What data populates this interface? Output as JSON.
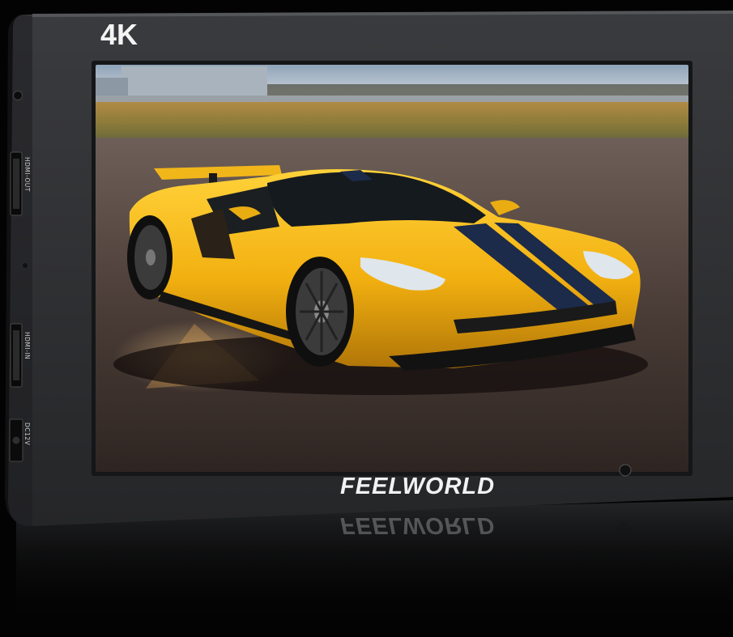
{
  "product": {
    "resolution_badge": "4K",
    "brand": "FEELWORLD"
  },
  "ports": {
    "hdmi_out": "HDMI-OUT",
    "hdmi_in": "HDMI-IN",
    "dc_in": "DC12V"
  },
  "colors": {
    "housing": "#2b2c2e",
    "bezel_edge": "#3a3b3e",
    "car_body": "#f5b312",
    "stripe": "#1c2b4a",
    "sky": "#b9c7d6",
    "asphalt": "#4a3a33"
  }
}
